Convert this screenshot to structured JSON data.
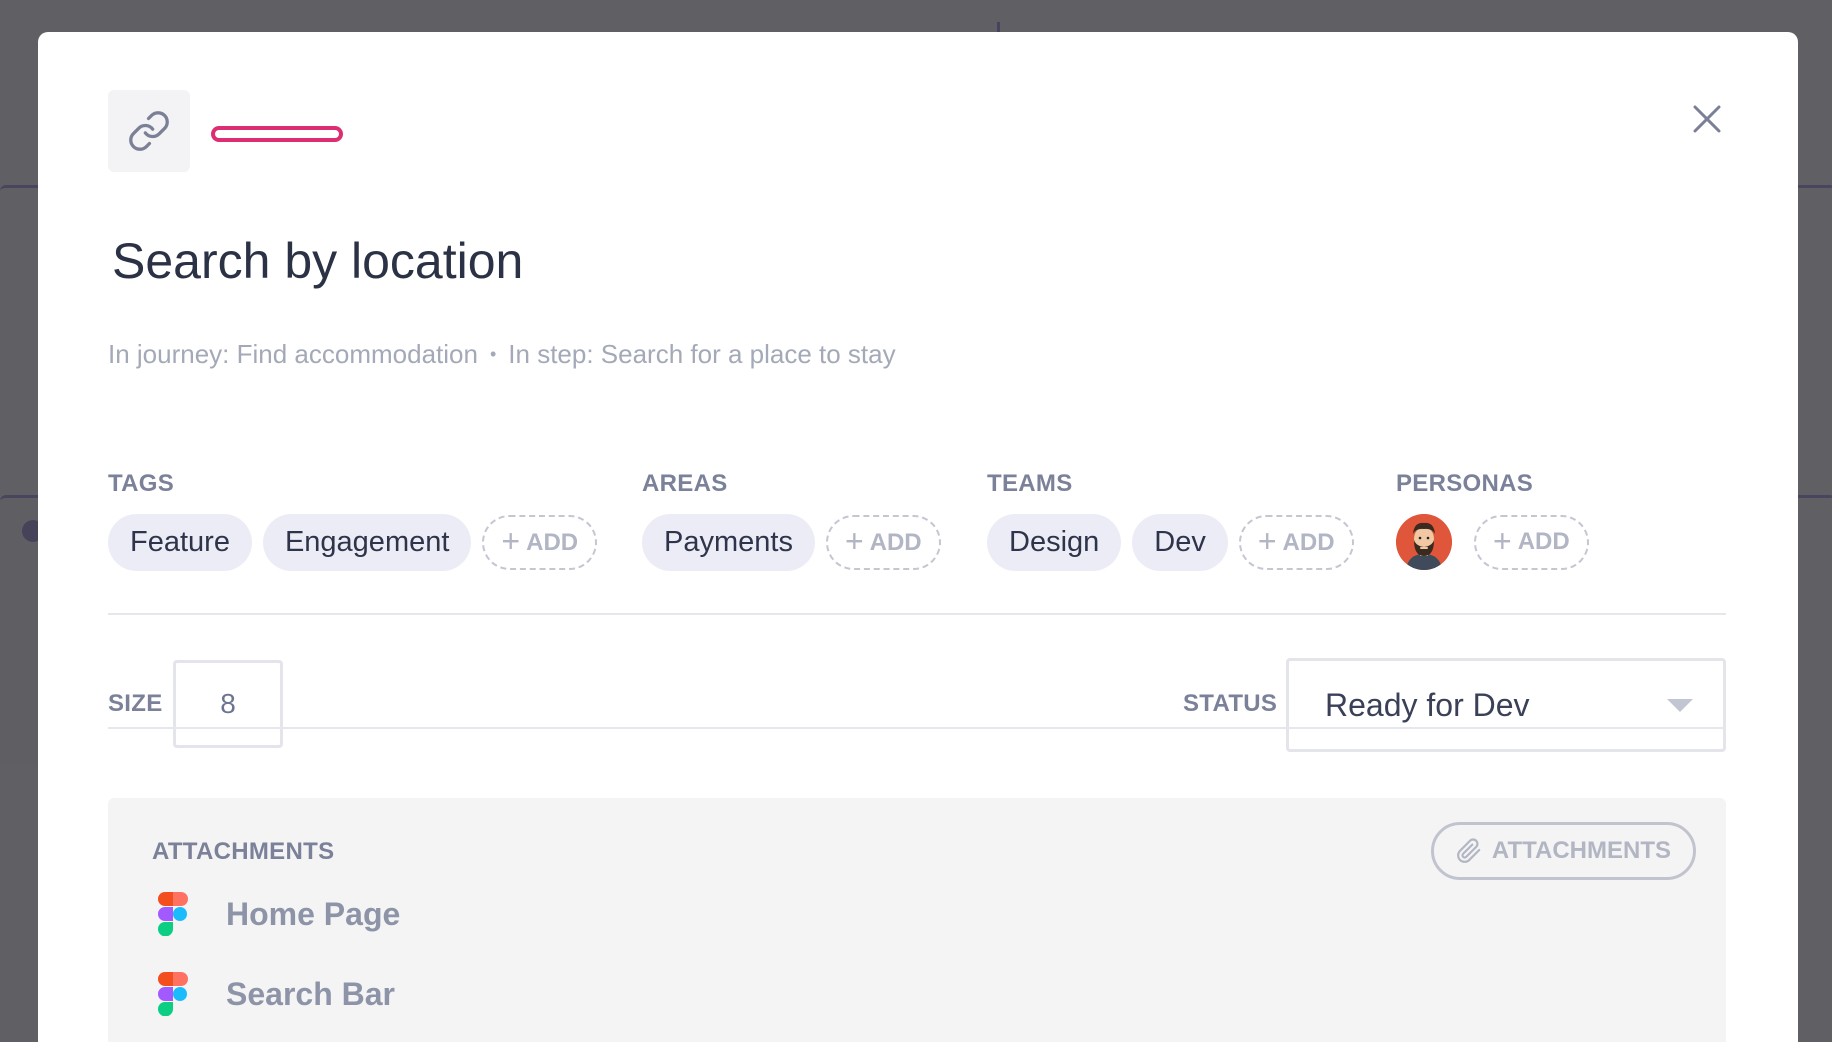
{
  "modal": {
    "title": "Search by location",
    "breadcrumb": {
      "journey": "In journey: Find accommodation",
      "separator": "•",
      "step": "In step: Search for a place to stay"
    },
    "accent_color": "#dc2f73"
  },
  "tags": {
    "label": "TAGS",
    "items": [
      "Feature",
      "Engagement"
    ],
    "add_label": "ADD"
  },
  "areas": {
    "label": "AREAS",
    "items": [
      "Payments"
    ],
    "add_label": "ADD"
  },
  "teams": {
    "label": "TEAMS",
    "items": [
      "Design",
      "Dev"
    ],
    "add_label": "ADD"
  },
  "personas": {
    "label": "PERSONAS",
    "avatar_icon": "bearded-man-avatar",
    "add_label": "ADD"
  },
  "size": {
    "label": "SIZE",
    "value": "8"
  },
  "status": {
    "label": "STATUS",
    "value": "Ready for Dev"
  },
  "attachments": {
    "label": "ATTACHMENTS",
    "button_label": "ATTACHMENTS",
    "files": [
      {
        "name": "Home Page",
        "icon": "figma-icon"
      },
      {
        "name": "Search Bar",
        "icon": "figma-icon"
      }
    ]
  }
}
